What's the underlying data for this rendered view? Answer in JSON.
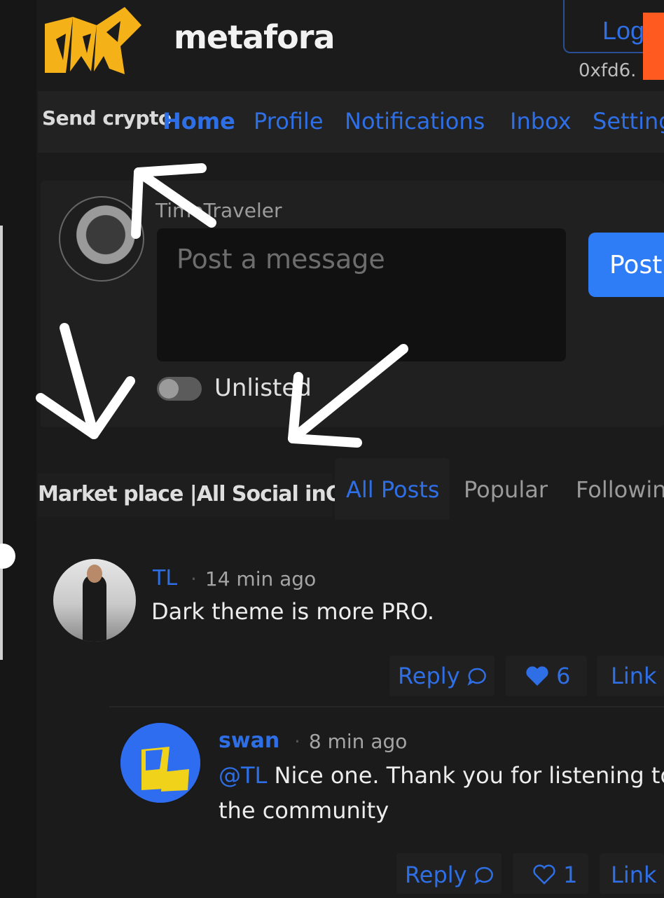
{
  "header": {
    "brand": "metafora",
    "logout_label": "Logo",
    "wallet_address": "0xfd6."
  },
  "nav": {
    "send_crypto": "Send crypto",
    "items": [
      "Home",
      "Profile",
      "Notifications",
      "Inbox",
      "Setting"
    ],
    "active": "Home"
  },
  "composer": {
    "username": "TimeTraveler",
    "placeholder": "Post a message",
    "post_label": "Post",
    "unlisted_label": "Unlisted"
  },
  "feed_tabs": {
    "marketplace_label": "Market place |All Social inOne",
    "tabs": [
      "All Posts",
      "Popular",
      "Followin"
    ],
    "active": "All Posts"
  },
  "posts": [
    {
      "user": "TL",
      "time": "14 min ago",
      "body": "Dark theme is more PRO.",
      "reply_label": "Reply",
      "likes": "6",
      "link_label": "Link"
    },
    {
      "user": "swan",
      "time": "8 min ago",
      "mention": "@TL",
      "body_line1": "Nice one. Thank you for listening to",
      "body_line2": "the community",
      "reply_label": "Reply",
      "likes": "1",
      "link_label": "Link"
    }
  ],
  "colors": {
    "background": "#1b1b1b",
    "accent_blue": "#2f6fe6",
    "brand_yellow": "#f5b218",
    "orange": "#ff5a1f"
  }
}
